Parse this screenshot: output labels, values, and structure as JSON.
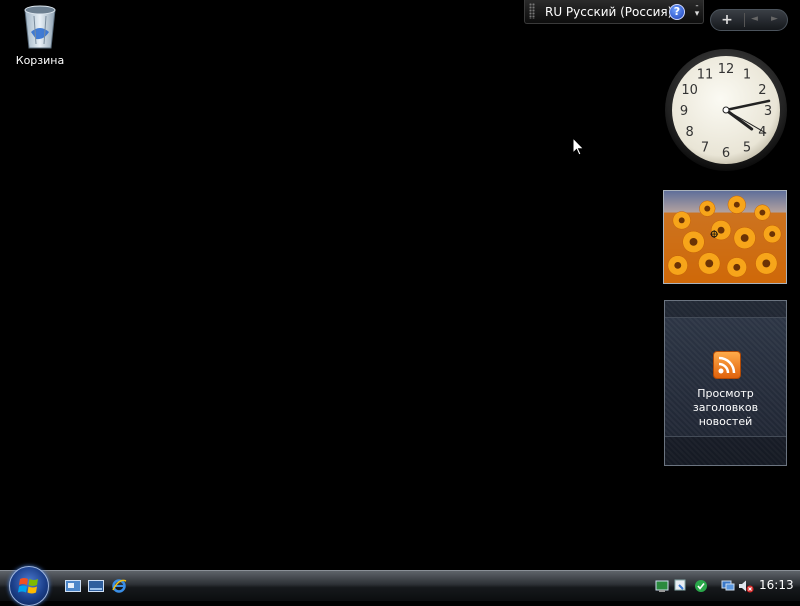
{
  "desktop": {
    "icons": [
      {
        "label": "Корзина",
        "icon": "recycle-bin-icon"
      }
    ]
  },
  "language_bar": {
    "language": "RU Русский (Россия)",
    "help_glyph": "?",
    "minimize_glyph": "-"
  },
  "sidebar": {
    "add_glyph": "+",
    "prev_glyph": "◄",
    "next_glyph": "►",
    "clock": {
      "numbers": [
        "12",
        "1",
        "2",
        "3",
        "4",
        "5",
        "6",
        "7",
        "8",
        "9",
        "10",
        "11"
      ],
      "hour": 4,
      "minute": 13,
      "second": 20
    },
    "feed_caption_line1": "Просмотр заголовков",
    "feed_caption_line2": "новостей"
  },
  "taskbar": {
    "clock_text": "16:13",
    "quick_launch": [
      "show-desktop-icon",
      "switch-windows-icon",
      "internet-explorer-icon"
    ],
    "tray_icons": [
      "network-icon",
      "defender-icon",
      "windows-update-icon",
      "network-status-icon",
      "volume-muted-icon"
    ]
  },
  "colors": {
    "desktop": "#000000",
    "start_orb": "#1b3f8a",
    "rss": "#f28a20"
  }
}
